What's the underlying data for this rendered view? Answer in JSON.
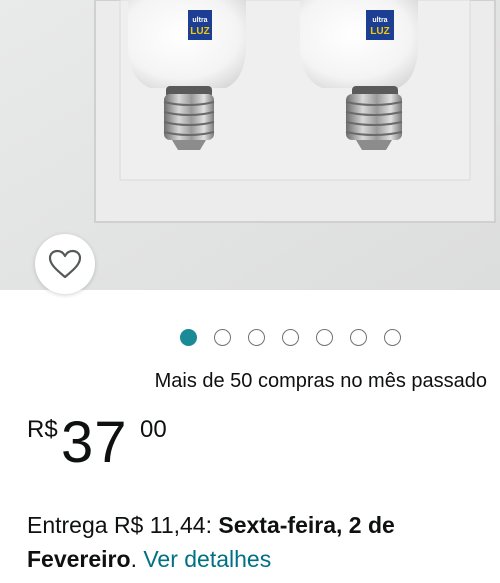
{
  "product": {
    "brand_badge_top": "ultra",
    "brand_badge_bottom": "LUZ",
    "image_dots": 7,
    "active_image_index": 0
  },
  "social_proof": "Mais de 50 compras no mês passado",
  "price": {
    "symbol": "R$",
    "whole": "37",
    "fraction": "00"
  },
  "delivery": {
    "prefix": "Entrega R$ 11,44: ",
    "date": "Sexta-feira, 2 de Fevereiro",
    "separator": ". ",
    "details_link": "Ver detalhes"
  },
  "colors": {
    "accent_teal": "#1a8b96",
    "link": "#007185",
    "text": "#0f1111",
    "badge_blue": "#1c3f94",
    "badge_yellow": "#f5c800"
  },
  "icons": {
    "wishlist": "heart-outline-icon"
  }
}
